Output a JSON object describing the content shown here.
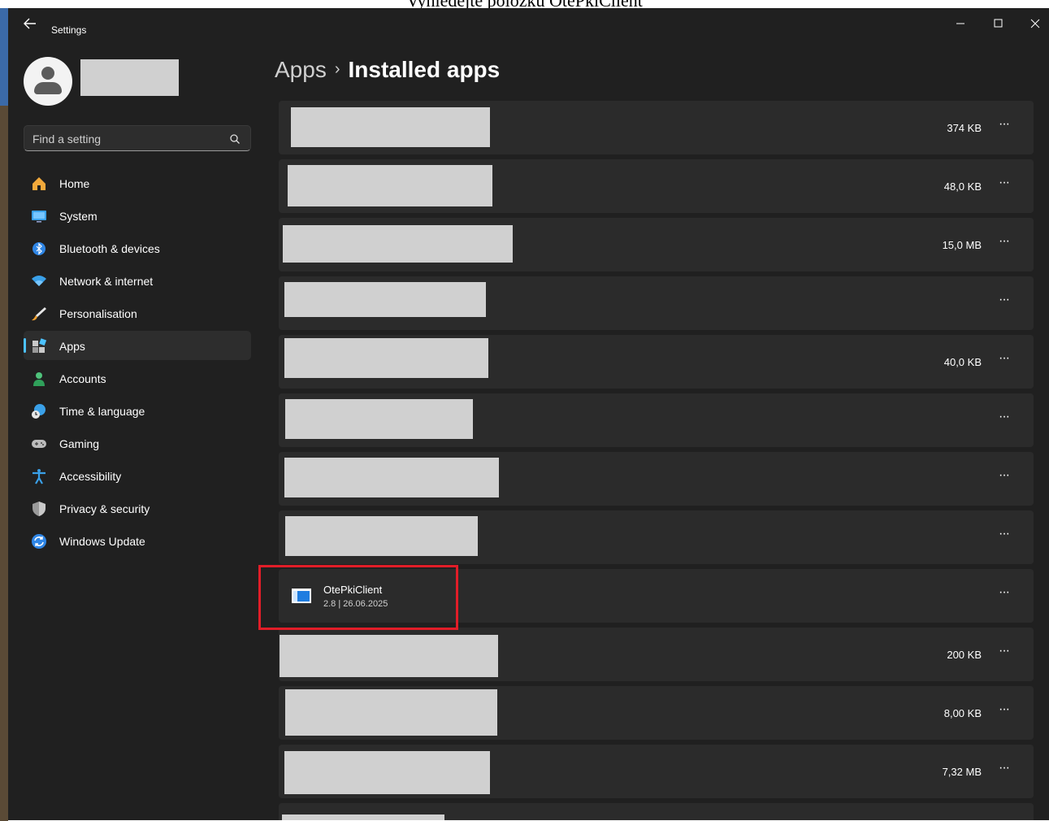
{
  "caption": "Vyhledejte položku OtePkiClient",
  "window": {
    "title": "Settings"
  },
  "search": {
    "placeholder": "Find a setting"
  },
  "nav": [
    {
      "label": "Home"
    },
    {
      "label": "System"
    },
    {
      "label": "Bluetooth & devices"
    },
    {
      "label": "Network & internet"
    },
    {
      "label": "Personalisation"
    },
    {
      "label": "Apps",
      "selected": true
    },
    {
      "label": "Accounts"
    },
    {
      "label": "Time & language"
    },
    {
      "label": "Gaming"
    },
    {
      "label": "Accessibility"
    },
    {
      "label": "Privacy & security"
    },
    {
      "label": "Windows Update"
    }
  ],
  "breadcrumb": {
    "parent": "Apps",
    "separator": "›",
    "current": "Installed apps"
  },
  "apps": [
    {
      "size": "374 KB"
    },
    {
      "size": "48,0 KB"
    },
    {
      "size": "15,0 MB"
    },
    {
      "size": ""
    },
    {
      "size": "40,0 KB"
    },
    {
      "size": ""
    },
    {
      "size": ""
    },
    {
      "size": ""
    },
    {
      "name": "OtePkiClient",
      "meta": "2.8  |  26.06.2025",
      "size": ""
    },
    {
      "size": "200 KB"
    },
    {
      "size": "8,00 KB"
    },
    {
      "size": "7,32 MB"
    }
  ],
  "more_label": "···",
  "colors": {
    "accent": "#4cc2ff",
    "highlight": "#e11d28",
    "redaction": "#d0d0d0"
  }
}
